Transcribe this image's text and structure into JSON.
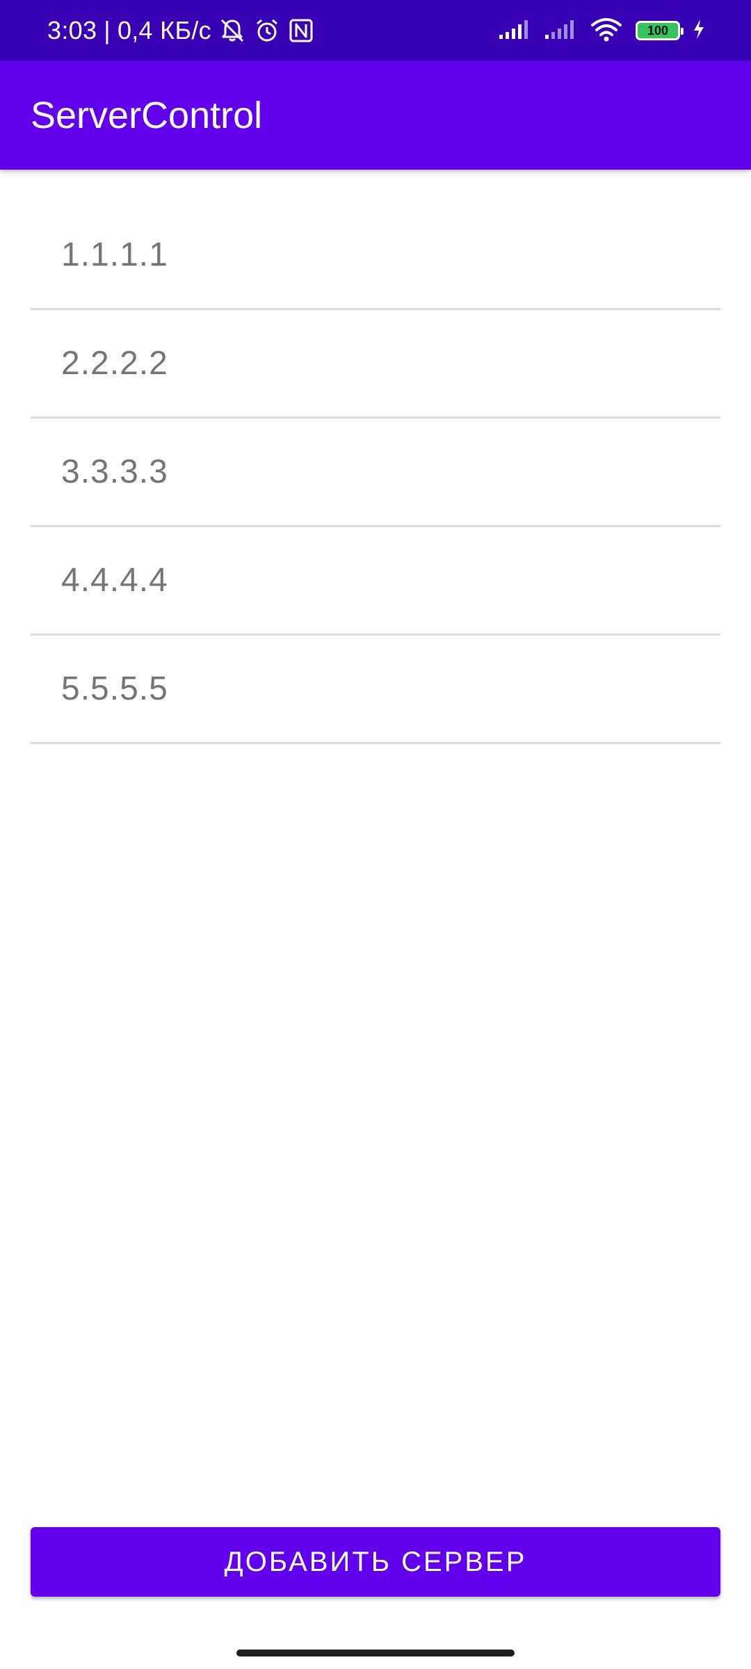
{
  "status_bar": {
    "time": "3:03",
    "separator": "|",
    "network_speed": "0,4 КБ/с",
    "icons_left": [
      "silent-icon",
      "alarm-icon",
      "nfc-icon"
    ],
    "icons_right": [
      "signal-icon",
      "signal-icon",
      "wifi-icon",
      "battery-icon",
      "charging-icon"
    ],
    "battery_level": "100"
  },
  "app_bar": {
    "title": "ServerControl"
  },
  "server_list": {
    "items": [
      {
        "label": "1.1.1.1"
      },
      {
        "label": "2.2.2.2"
      },
      {
        "label": "3.3.3.3"
      },
      {
        "label": "4.4.4.4"
      },
      {
        "label": "5.5.5.5"
      }
    ]
  },
  "actions": {
    "add_server_label": "ДОБАВИТЬ СЕРВЕР"
  },
  "colors": {
    "status_bar": "#3700b3",
    "primary": "#6200ee",
    "list_text": "#757575",
    "divider": "#dcdcdc",
    "battery_fill": "#35c45c"
  }
}
